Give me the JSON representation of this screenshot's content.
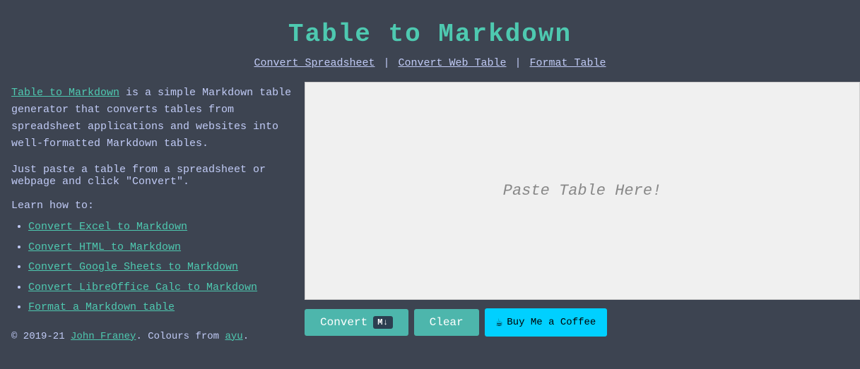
{
  "header": {
    "title": "Table to Markdown",
    "nav": [
      {
        "label": "Convert Spreadsheet",
        "id": "convert-spreadsheet"
      },
      {
        "label": "Convert Web Table",
        "id": "convert-web-table"
      },
      {
        "label": "Format Table",
        "id": "format-table"
      }
    ],
    "separators": [
      "|",
      "|"
    ]
  },
  "sidebar": {
    "brand_link": "Table to Markdown",
    "description_text": " is a simple Markdown table generator that converts tables from spreadsheet applications and websites into well-formatted Markdown tables.",
    "instruction": "Just paste a table from a spreadsheet or webpage and click \"Convert\".",
    "learn_how": "Learn how to:",
    "links": [
      {
        "label": "Convert Excel to Markdown"
      },
      {
        "label": "Convert HTML to Markdown"
      },
      {
        "label": "Convert Google Sheets to Markdown"
      },
      {
        "label": "Convert LibreOffice Calc to Markdown"
      },
      {
        "label": "Format a Markdown table"
      }
    ],
    "footer": "© 2019-21 ",
    "footer_author": "John Franey",
    "footer_middle": ". Colours from ",
    "footer_ayu": "ayu",
    "footer_end": "."
  },
  "editor": {
    "placeholder": "Paste Table Here!"
  },
  "buttons": {
    "convert_label": "Convert",
    "md_badge": "M↓",
    "clear_label": "Clear",
    "coffee_label": "Buy Me a Coffee"
  }
}
